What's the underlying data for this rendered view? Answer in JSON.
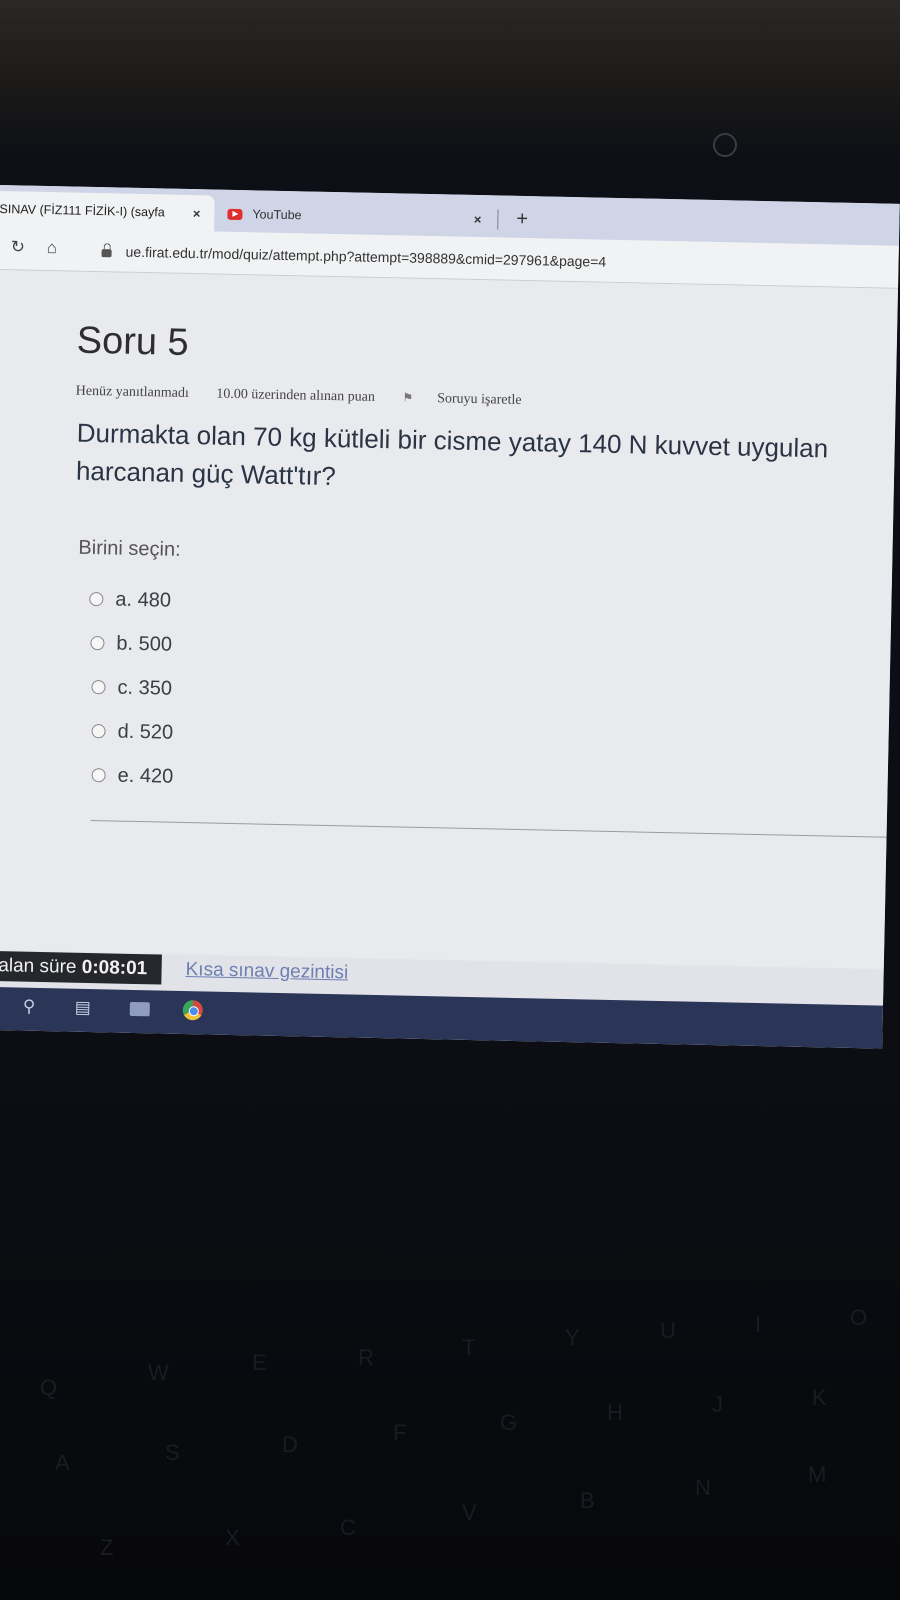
{
  "browser": {
    "tabs": [
      {
        "title": "SINAV (FİZ111 FİZİK-I) (sayfa",
        "close": "×"
      },
      {
        "title": "YouTube",
        "close": "×"
      }
    ],
    "new_tab": "+",
    "url": "ue.firat.edu.tr/mod/quiz/attempt.php?attempt=398889&cmid=297961&page=4"
  },
  "question": {
    "title": "Soru 5",
    "status": "Henüz yanıtlanmadı",
    "points": "10.00 üzerinden alınan puan",
    "flag_label": "Soruyu işaretle",
    "text_line1": "Durmakta olan 70 kg kütleli bir cisme yatay 140 N kuvvet uygulan",
    "text_line2": "harcanan güç Watt'tır?",
    "prompt": "Birini seçin:",
    "options": [
      "a. 480",
      "b. 500",
      "c. 350",
      "d. 520",
      "e. 420"
    ]
  },
  "footer": {
    "timer_label": "Kalan süre",
    "timer_value": "0:08:01",
    "nav_link": "Kısa sınav gezintisi"
  },
  "icons": {
    "reload": "reload-icon",
    "home": "home-icon",
    "lock": "lock-icon",
    "search": "search-icon",
    "task_view": "task-view-icon",
    "browser": "chrome-icon"
  },
  "keyboard_keys": [
    "Q",
    "W",
    "E",
    "R",
    "T",
    "Y",
    "U",
    "I",
    "O",
    "A",
    "S",
    "D",
    "F",
    "G",
    "H",
    "J",
    "K",
    "Z",
    "X",
    "C",
    "V",
    "B",
    "N",
    "M"
  ]
}
